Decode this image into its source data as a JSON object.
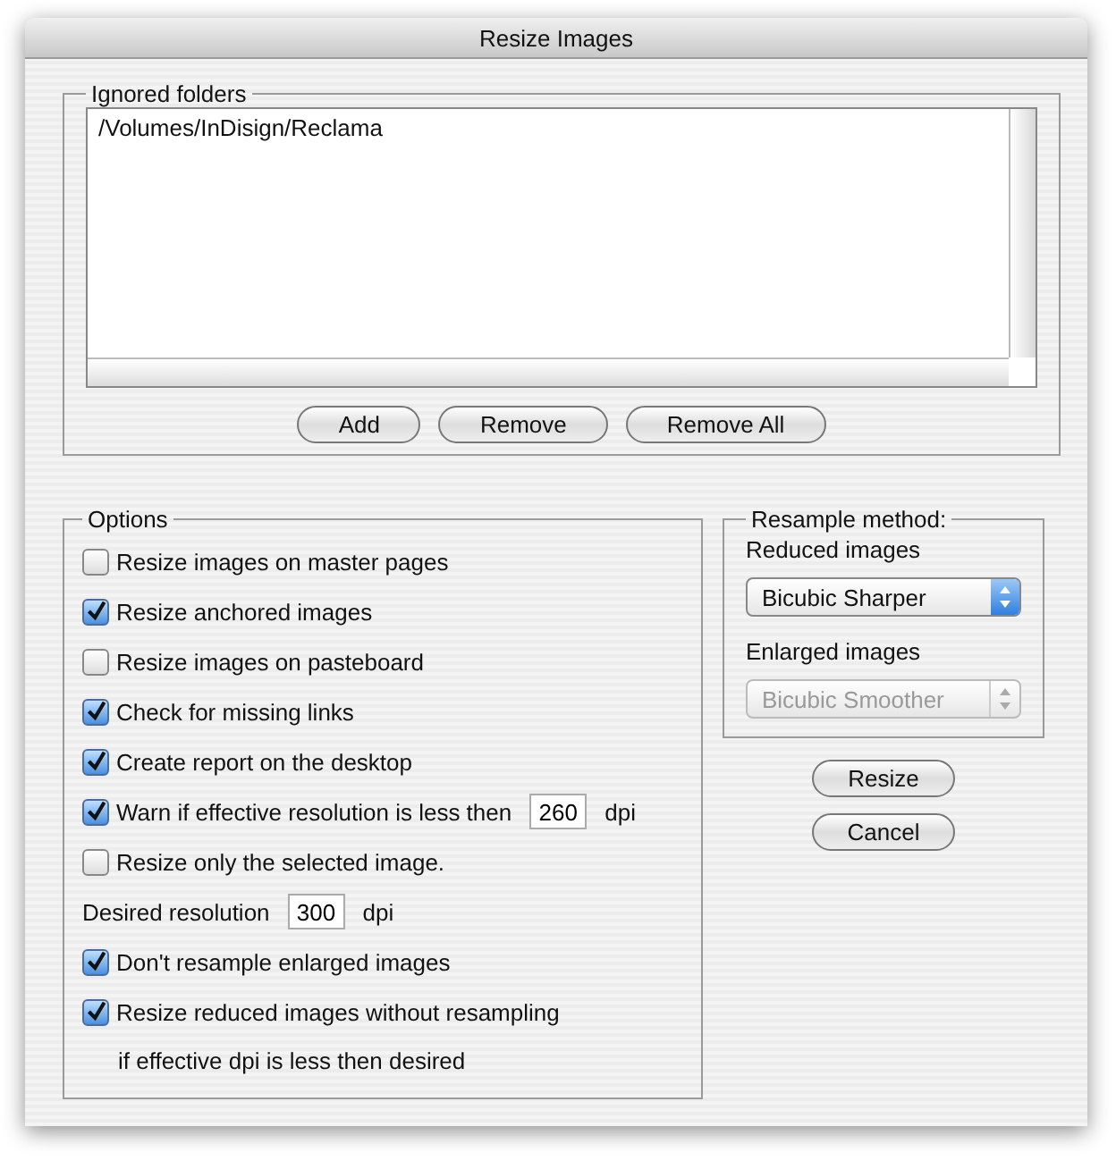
{
  "window": {
    "title": "Resize Images"
  },
  "ignored_folders": {
    "legend": "Ignored folders",
    "items": [
      "/Volumes/InDisign/Reclama"
    ],
    "buttons": [
      "Add",
      "Remove",
      "Remove All"
    ]
  },
  "options": {
    "legend": "Options",
    "items": [
      {
        "kind": "checkbox",
        "label": "Resize images on master pages",
        "checked": false
      },
      {
        "kind": "checkbox",
        "label": "Resize anchored images",
        "checked": true
      },
      {
        "kind": "checkbox",
        "label": "Resize images on pasteboard",
        "checked": false
      },
      {
        "kind": "checkbox",
        "label": "Check for missing links",
        "checked": true
      },
      {
        "kind": "checkbox",
        "label": "Create report on the desktop",
        "checked": true
      },
      {
        "kind": "checkbox_field",
        "label": "Warn if effective resolution is less then",
        "checked": true,
        "value": "260",
        "unit": "dpi"
      },
      {
        "kind": "checkbox",
        "label": "Resize only the selected image.",
        "checked": false
      },
      {
        "kind": "field",
        "label": "Desired resolution",
        "value": "300",
        "unit": "dpi"
      },
      {
        "kind": "checkbox",
        "label": "Don't resample enlarged images",
        "checked": true
      },
      {
        "kind": "checkbox",
        "label": "Resize reduced images without resampling",
        "checked": true
      },
      {
        "kind": "note",
        "label": "if effective dpi is less then desired"
      }
    ]
  },
  "resample": {
    "legend": "Resample method:",
    "popups": [
      {
        "label": "Reduced images",
        "value": "Bicubic Sharper",
        "disabled": false
      },
      {
        "label": "Enlarged images",
        "value": "Bicubic Smoother",
        "disabled": true
      }
    ]
  },
  "buttons": [
    "Resize",
    "Cancel"
  ]
}
